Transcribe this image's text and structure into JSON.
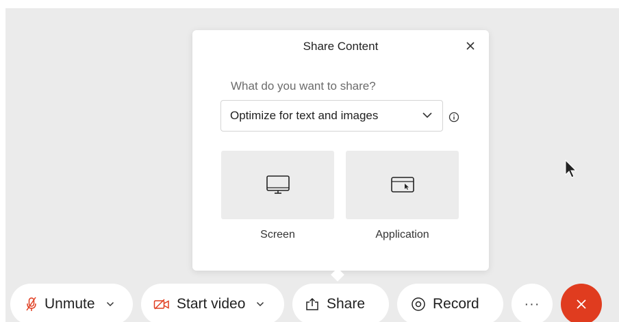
{
  "dialog": {
    "title": "Share Content",
    "prompt": "What do you want to share?",
    "optimize_select": {
      "value": "Optimize for text and images"
    },
    "options": [
      {
        "label": "Screen",
        "icon": "monitor-icon"
      },
      {
        "label": "Application",
        "icon": "application-window-icon"
      }
    ]
  },
  "toolbar": {
    "unmute_label": "Unmute",
    "start_video_label": "Start video",
    "share_label": "Share",
    "record_label": "Record",
    "more_label": "···"
  },
  "colors": {
    "accent_red": "#e03c1f",
    "stage_bg": "#ebebeb"
  }
}
